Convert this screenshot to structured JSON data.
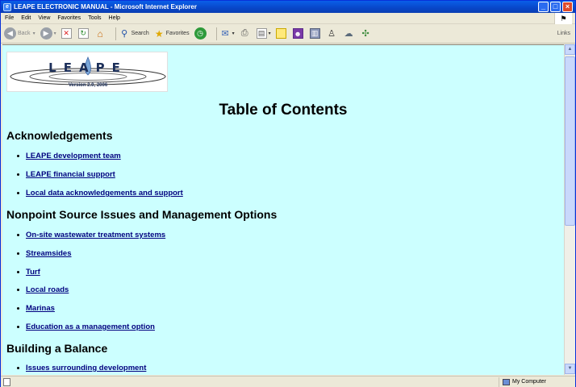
{
  "window": {
    "title": "LEAPE ELECTRONIC MANUAL - Microsoft Internet Explorer",
    "minimize": "_",
    "maximize": "□",
    "close": "×"
  },
  "menu": [
    "File",
    "Edit",
    "View",
    "Favorites",
    "Tools",
    "Help"
  ],
  "toolbar": {
    "back_label": "Back",
    "search_label": "Search",
    "favorites_label": "Favorites",
    "links_label": "Links"
  },
  "page": {
    "logo_text": "LEAPE",
    "logo_version": "Version 2.0, 2006",
    "title": "Table of Contents",
    "sections": [
      {
        "heading": "Acknowledgements",
        "links": [
          "LEAPE development team",
          "LEAPE financial support",
          "Local data acknowledgements and support"
        ]
      },
      {
        "heading": "Nonpoint Source Issues and Management Options",
        "links": [
          "On-site wastewater treatment systems",
          "Streamsides",
          "Turf",
          "Local roads",
          "Marinas",
          "Education as a management option"
        ]
      },
      {
        "heading": "Building a Balance",
        "links": [
          "Issues surrounding development"
        ]
      }
    ]
  },
  "status": {
    "zone": "My Computer"
  },
  "colors": {
    "page_background": "#ccffff",
    "link": "#00007f",
    "titlebar": "#0846c8"
  }
}
